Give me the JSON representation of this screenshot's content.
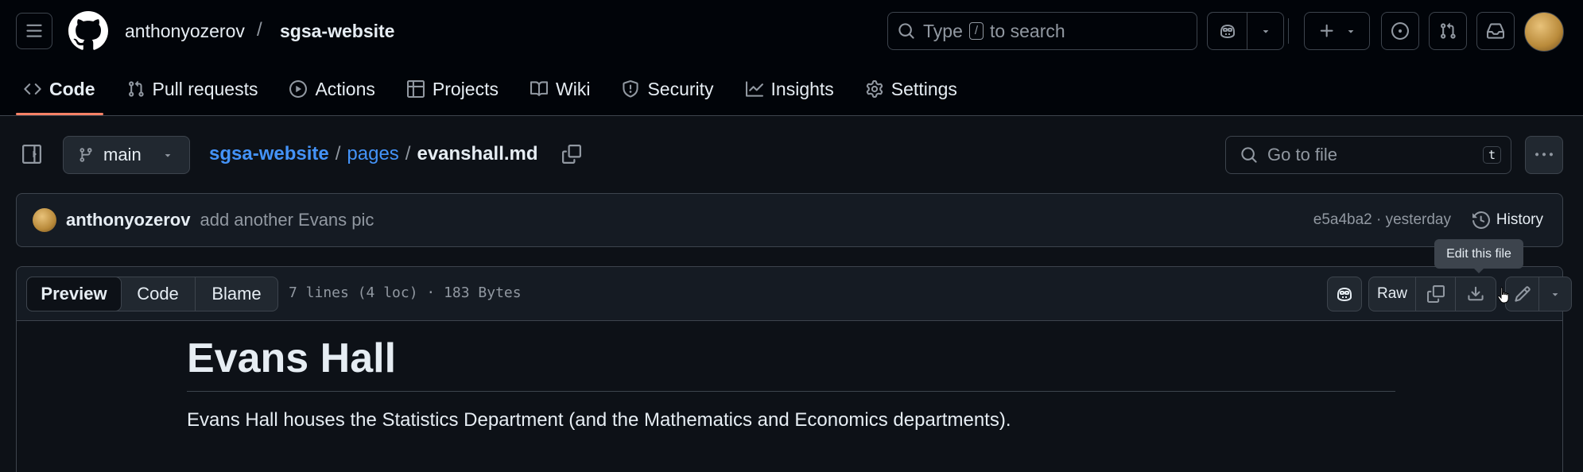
{
  "header": {
    "owner": "anthonyozerov",
    "separator": "/",
    "repo": "sgsa-website",
    "search": {
      "prefix": "Type",
      "key": "/",
      "suffix": "to search"
    }
  },
  "repo_nav": {
    "items": [
      {
        "label": "Code",
        "icon": "code-icon",
        "active": true
      },
      {
        "label": "Pull requests",
        "icon": "git-pull-request-icon"
      },
      {
        "label": "Actions",
        "icon": "play-icon"
      },
      {
        "label": "Projects",
        "icon": "table-icon"
      },
      {
        "label": "Wiki",
        "icon": "book-icon"
      },
      {
        "label": "Security",
        "icon": "shield-icon"
      },
      {
        "label": "Insights",
        "icon": "graph-icon"
      },
      {
        "label": "Settings",
        "icon": "gear-icon"
      }
    ]
  },
  "file": {
    "branch": "main",
    "path": {
      "repo": "sgsa-website",
      "sep1": "/",
      "dir": "pages",
      "sep2": "/",
      "name": "evanshall.md"
    },
    "goto_placeholder": "Go to file",
    "goto_key": "t"
  },
  "commit": {
    "author": "anthonyozerov",
    "message": "add another Evans pic",
    "hash_time": "e5a4ba2 · yesterday",
    "history_label": "History"
  },
  "tooltip": "Edit this file",
  "toolbar": {
    "tabs": [
      "Preview",
      "Code",
      "Blame"
    ],
    "selected_tab": "Preview",
    "file_info": "7 lines (4 loc) · 183 Bytes",
    "raw_label": "Raw"
  },
  "content": {
    "title": "Evans Hall",
    "paragraph": "Evans Hall houses the Statistics Department (and the Mathematics and Economics departments)."
  },
  "colors": {
    "background": "#0d1117",
    "header_bg": "#010409",
    "accent_underline": "#f78166",
    "link": "#4493f8",
    "border": "#3d444d",
    "muted_text": "#9198a1"
  }
}
